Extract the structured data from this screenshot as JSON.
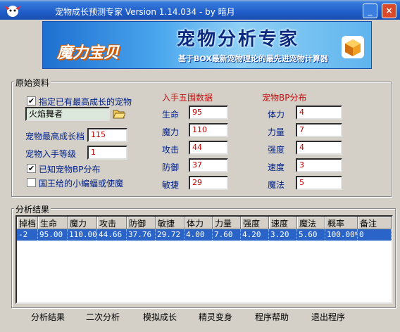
{
  "window": {
    "title": "宠物成长预测专家 Version 1.14.034 - by 暗月",
    "minimize": "_",
    "close": "×"
  },
  "banner": {
    "logo_text": "魔力宝贝",
    "title": "宠物分析专家",
    "subtitle": "基于BOX最新宠物理论的最先进宠物计算器"
  },
  "source_group": {
    "label": "原始资料",
    "chk_max_growth": {
      "label": "指定已有最高成长的宠物",
      "checked": true
    },
    "pet_name": "火焰舞者",
    "max_growth_label": "宠物最高成长档",
    "max_growth_value": "115",
    "level_label": "宠物入手等级",
    "level_value": "1",
    "chk_known_bp": {
      "label": "已知宠物BP分布",
      "checked": true
    },
    "chk_king_bat": {
      "label": "国王给的小蝙蝠或使魔",
      "checked": false
    }
  },
  "initial_stats": {
    "header": "入手五围数据",
    "rows": [
      {
        "label": "生命",
        "value": "95"
      },
      {
        "label": "魔力",
        "value": "110"
      },
      {
        "label": "攻击",
        "value": "44"
      },
      {
        "label": "防御",
        "value": "37"
      },
      {
        "label": "敏捷",
        "value": "29"
      }
    ]
  },
  "bp_dist": {
    "header": "宠物BP分布",
    "rows": [
      {
        "label": "体力",
        "value": "4"
      },
      {
        "label": "力量",
        "value": "7"
      },
      {
        "label": "强度",
        "value": "4"
      },
      {
        "label": "速度",
        "value": "3"
      },
      {
        "label": "魔法",
        "value": "5"
      }
    ]
  },
  "results": {
    "label": "分析结果",
    "columns": [
      "掉档",
      "生命",
      "魔力",
      "攻击",
      "防御",
      "敏捷",
      "体力",
      "力量",
      "强度",
      "速度",
      "魔法",
      "概率",
      "备注"
    ],
    "rows": [
      [
        "-2",
        "95.00",
        "110.00",
        "44.66",
        "37.76",
        "29.72",
        "4.00",
        "7.60",
        "4.20",
        "3.20",
        "5.60",
        "100.00%",
        "0"
      ]
    ]
  },
  "buttons": {
    "analyze": "分析结果",
    "second": "二次分析",
    "simulate": "模拟成长",
    "transform": "精灵变身",
    "help": "程序帮助",
    "exit": "退出程序"
  },
  "colors": {
    "title_bar": "#1f5cc8",
    "section_header": "#c01010",
    "selected_row": "#2a64c8"
  }
}
